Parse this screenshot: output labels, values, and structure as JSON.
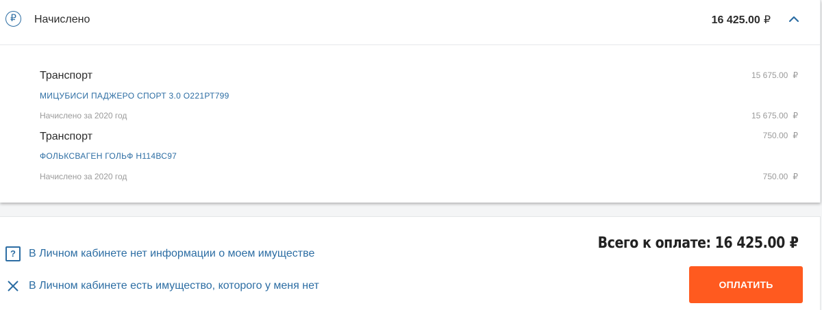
{
  "accrued": {
    "title": "Начислено",
    "amount": "16 425.00",
    "currency": "₽",
    "icon": "ruble-circle-icon",
    "toggle_icon": "chevron-up-icon"
  },
  "items": [
    {
      "type": "Транспорт",
      "amount": "15 675.00",
      "vehicle": "МИЦУБИСИ ПАДЖЕРО СПОРТ 3.0 О221РТ799",
      "note": "Начислено за 2020 год",
      "note_amount": "15 675.00"
    },
    {
      "type": "Транспорт",
      "amount": "750.00",
      "vehicle": "ФОЛЬКСВАГЕН ГОЛЬФ Н114ВС97",
      "note": "Начислено за 2020 год",
      "note_amount": "750.00"
    }
  ],
  "links": {
    "no_info": "В Личном кабинете нет информации о моем имуществе",
    "not_mine": "В Личном кабинете есть имущество, которого у меня нет"
  },
  "total": {
    "label": "Всего к оплате: 16 425.00",
    "currency": "₽"
  },
  "pay_button": "ОПЛАТИТЬ",
  "colors": {
    "accent_blue": "#2c6da3",
    "pay_orange": "#ff5a1f",
    "muted_text": "#9a9a9a"
  }
}
